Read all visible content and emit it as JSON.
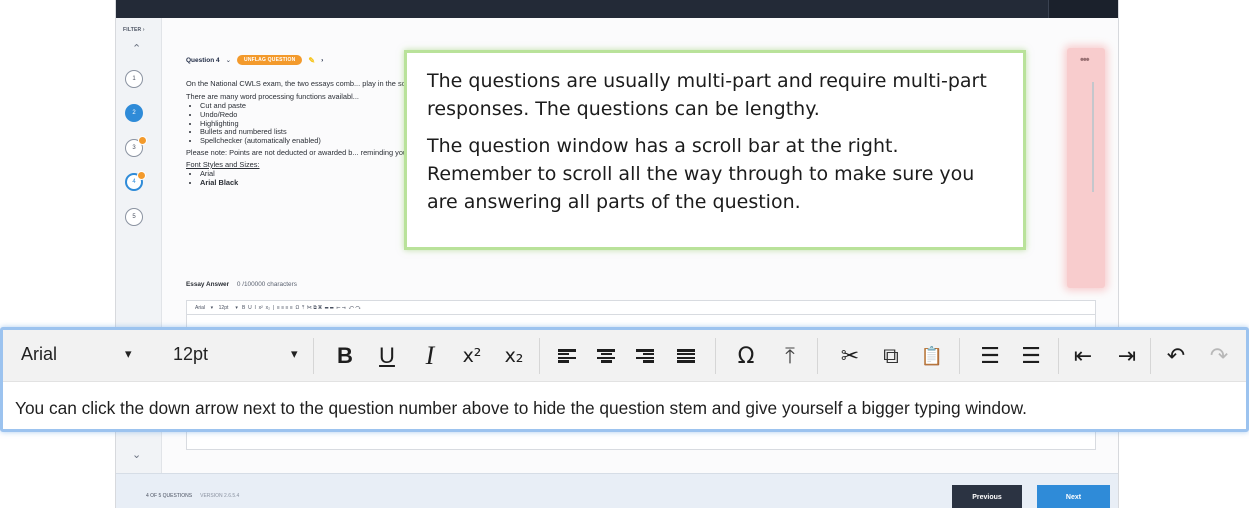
{
  "app": {
    "filter_label": "FILTER",
    "question_numbers": [
      "1",
      "2",
      "3",
      "4",
      "5"
    ],
    "question_title": "Question 4",
    "unflag_label": "UNFLAG QUESTION",
    "question_text": {
      "para1": "On the National CWLS exam, the two essays comb... play in the scenario; and you will be asked how you would app... ations. The questions are usually multi-part and require multi-p... e bottom of the window to make sure you are answering all parts of...",
      "intro_list": "There are many word processing functions availabl...",
      "functions": [
        "Cut and paste",
        "Undo/Redo",
        "Highlighting",
        "Bullets and numbered lists",
        "Spellchecker (automatically enabled)"
      ],
      "para2": "Please note: Points are not deducted or awarded b... reminding you about scrolling!",
      "font_heading": "Font Styles and Sizes:",
      "fonts": [
        "Arial",
        "Arial Black"
      ]
    },
    "essay_label": "Essay Answer",
    "essay_count": "0 /100000 characters",
    "mini_toolbar_font": "Arial",
    "mini_toolbar_size": "12pt",
    "footer_status": "4 OF 5 QUESTIONS",
    "footer_version": "VERSION 2.6.5.4",
    "previous_label": "Previous",
    "next_label": "Next"
  },
  "callout": {
    "p1": "The questions are usually multi-part and require multi-part responses. The questions can be lengthy.",
    "p2": "The question window has a scroll bar at the right. Remember to scroll all the way through to make sure you are answering all parts of the question."
  },
  "zoom_toolbar": {
    "font": "Arial",
    "size": "12pt",
    "caret": "▾",
    "bold": "B",
    "underline": "U",
    "italic": "I",
    "superscript": "x²",
    "subscript": "x₂",
    "omega": "Ω",
    "hr": "⤒",
    "cut": "✂",
    "copy": "⧉",
    "paste": "📋",
    "numbered": "☰",
    "bulleted": "☰",
    "outdent": "⇤",
    "indent": "⇥",
    "undo": "↶",
    "redo": "↷"
  },
  "zoom_hint": "You can click the down arrow next to the question number above to hide the question stem and give yourself a bigger typing window."
}
